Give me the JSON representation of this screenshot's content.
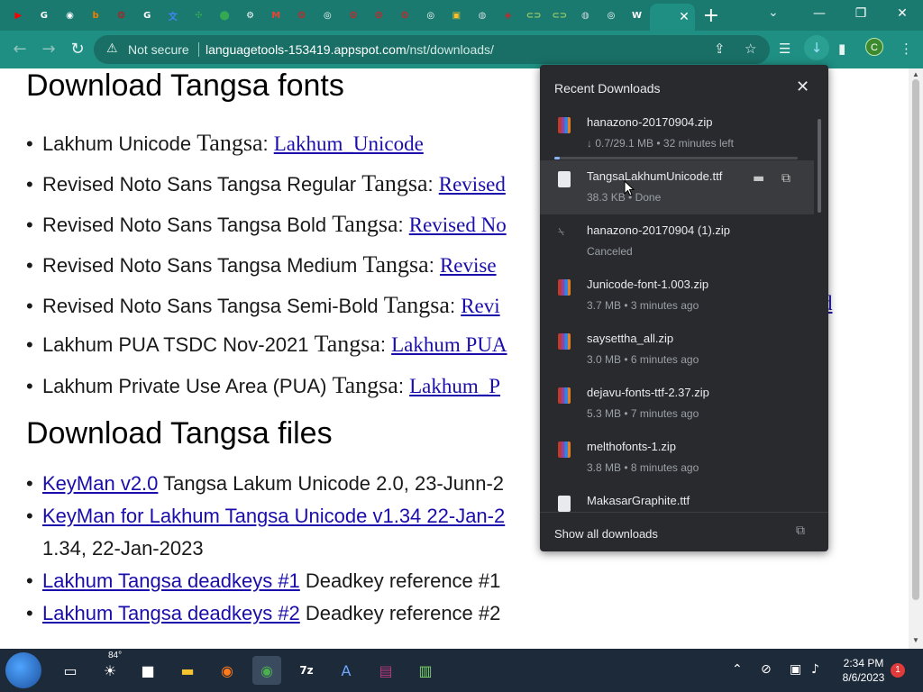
{
  "browser": {
    "tab_favicons": [
      {
        "name": "youtube-icon",
        "color": "#ff0000",
        "glyph": "▶"
      },
      {
        "name": "google-icon",
        "color": "#ffffff",
        "glyph": "G"
      },
      {
        "name": "chrome-icon",
        "color": "#ffffff",
        "glyph": "◉"
      },
      {
        "name": "blogger-icon",
        "color": "#f57d00",
        "glyph": "b"
      },
      {
        "name": "script-icon",
        "color": "#b71c1c",
        "glyph": "❂"
      },
      {
        "name": "google-icon",
        "color": "#ffffff",
        "glyph": "G"
      },
      {
        "name": "translate-icon",
        "color": "#4285f4",
        "glyph": "文"
      },
      {
        "name": "pinwheel-icon",
        "color": "#34a853",
        "glyph": "✣"
      },
      {
        "name": "maps-icon",
        "color": "#34a853",
        "glyph": "⬤"
      },
      {
        "name": "settings-icon",
        "color": "#ffffff",
        "glyph": "⚙"
      },
      {
        "name": "gmail-icon",
        "color": "#ea4335",
        "glyph": "M"
      },
      {
        "name": "script-icon",
        "color": "#c62828",
        "glyph": "❂"
      },
      {
        "name": "github-icon",
        "color": "#ffffff",
        "glyph": "◎"
      },
      {
        "name": "script-icon",
        "color": "#c62828",
        "glyph": "❂"
      },
      {
        "name": "script-icon",
        "color": "#c62828",
        "glyph": "❂"
      },
      {
        "name": "script-icon",
        "color": "#c62828",
        "glyph": "❂"
      },
      {
        "name": "github-icon",
        "color": "#ffffff",
        "glyph": "◎"
      },
      {
        "name": "photo-icon",
        "color": "#fbc02d",
        "glyph": "▣"
      },
      {
        "name": "globe-icon",
        "color": "#cfd8dc",
        "glyph": "◍"
      },
      {
        "name": "script-icon",
        "color": "#c62828",
        "glyph": "◈"
      },
      {
        "name": "link-icon",
        "color": "#9ccc65",
        "glyph": "⊂⊃"
      },
      {
        "name": "link-icon",
        "color": "#9ccc65",
        "glyph": "⊂⊃"
      },
      {
        "name": "globe-icon",
        "color": "#cfd8dc",
        "glyph": "◍"
      },
      {
        "name": "github-icon",
        "color": "#ffffff",
        "glyph": "◎"
      },
      {
        "name": "wikipedia-icon",
        "color": "#ffffff",
        "glyph": "W"
      }
    ],
    "active_tab_close": "✕",
    "new_tab": "+",
    "window_controls": {
      "tab_search": "⌄",
      "minimize": "—",
      "restore": "❐",
      "close": "✕"
    },
    "address": {
      "not_secure": "Not secure",
      "url_host": "languagetools-153419.appspot.com",
      "url_path": "/nst/downloads/"
    },
    "profile_initial": "C"
  },
  "page": {
    "heading_fonts": "Download Tangsa fonts",
    "font_items": [
      {
        "label": "Lakhum Unicode ",
        "word": "Tangsa",
        "link": "Lakhum_Unicode"
      },
      {
        "label": "Revised Noto Sans Tangsa Regular ",
        "word": "Tangsa",
        "link": "Revised"
      },
      {
        "label": "Revised Noto Sans Tangsa Bold ",
        "word": "Tangsa",
        "link": "Revised No"
      },
      {
        "label": "Revised Noto Sans Tangsa Medium ",
        "word": "Tangsa",
        "link": "Revise"
      },
      {
        "label": "Revised Noto Sans Tangsa Semi-Bold ",
        "word": "Tangsa",
        "link": "Revi"
      },
      {
        "label": "Lakhum PUA TSDC Nov-2021 ",
        "word": "Tangsa",
        "link": "Lakhum PUA"
      },
      {
        "label": "Lakhum Private Use Area (PUA) ",
        "word": "Tangsa",
        "link": "Lakhum_P"
      }
    ],
    "semibold_link_tail": "d",
    "heading_files": "Download Tangsa files",
    "file_items": [
      {
        "link": "KeyMan v2.0",
        "text": " Tangsa Lakum Unicode 2.0, 23-Junn-2"
      },
      {
        "link": "KeyMan for Lakhum Tangsa Unicode v1.34 22-Jan-2",
        "text": ""
      },
      {
        "link": "",
        "text": "1.34, 22-Jan-2023"
      },
      {
        "link": "Lakhum Tangsa deadkeys #1",
        "text": " Deadkey reference #1"
      },
      {
        "link": "Lakhum Tangsa deadkeys #2",
        "text": " Deadkey reference #2"
      }
    ]
  },
  "downloads": {
    "title": "Recent Downloads",
    "items": [
      {
        "name": "hanazono-20170904.zip",
        "status": "↓ 0.7/29.1 MB • 32 minutes left",
        "icon": "zip",
        "progress": 0.024
      },
      {
        "name": "TangsaLakhumUnicode.ttf",
        "status": "38.3 KB • Done",
        "icon": "ttf"
      },
      {
        "name": "hanazono-20170904 (1).zip",
        "status": "Canceled",
        "icon": "cancel"
      },
      {
        "name": "Junicode-font-1.003.zip",
        "status": "3.7 MB • 3 minutes ago",
        "icon": "zip"
      },
      {
        "name": "saysettha_all.zip",
        "status": "3.0 MB • 6 minutes ago",
        "icon": "zip"
      },
      {
        "name": "dejavu-fonts-ttf-2.37.zip",
        "status": "5.3 MB • 7 minutes ago",
        "icon": "zip"
      },
      {
        "name": "melthofonts-1.zip",
        "status": "3.8 MB • 8 minutes ago",
        "icon": "zip"
      },
      {
        "name": "MakasarGraphite.ttf",
        "status": "",
        "icon": "ttf"
      }
    ],
    "show_all": "Show all downloads"
  },
  "taskbar": {
    "temperature": "84°",
    "time": "2:34 PM",
    "date": "8/6/2023",
    "notifications": "1"
  }
}
